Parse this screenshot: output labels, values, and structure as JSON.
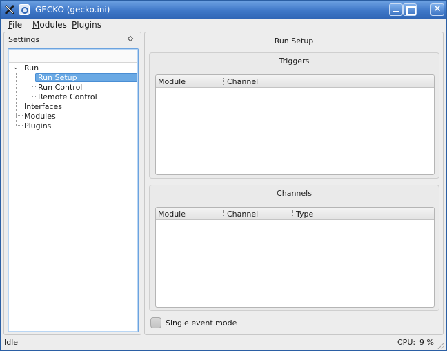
{
  "window": {
    "title": "GECKO (gecko.ini)"
  },
  "menubar": {
    "items": [
      "File",
      "Modules",
      "Plugins"
    ]
  },
  "settings_dock": {
    "title": "Settings",
    "tree": {
      "run": "Run",
      "run_children": [
        "Run Setup",
        "Run Control",
        "Remote Control"
      ],
      "others": [
        "Interfaces",
        "Modules",
        "Plugins"
      ],
      "selected": "Run Setup"
    }
  },
  "main": {
    "title": "Run Setup",
    "triggers": {
      "title": "Triggers",
      "columns": [
        "Module",
        "Channel"
      ]
    },
    "channels": {
      "title": "Channels",
      "columns": [
        "Module",
        "Channel",
        "Type"
      ]
    },
    "single_event_mode": {
      "label": "Single event mode",
      "checked": false
    }
  },
  "status": {
    "text": "Idle",
    "cpu_label": "CPU:",
    "cpu_value": "9 %"
  },
  "colors": {
    "titlebar": "#3f78c8",
    "selection": "#6aa9e4"
  }
}
